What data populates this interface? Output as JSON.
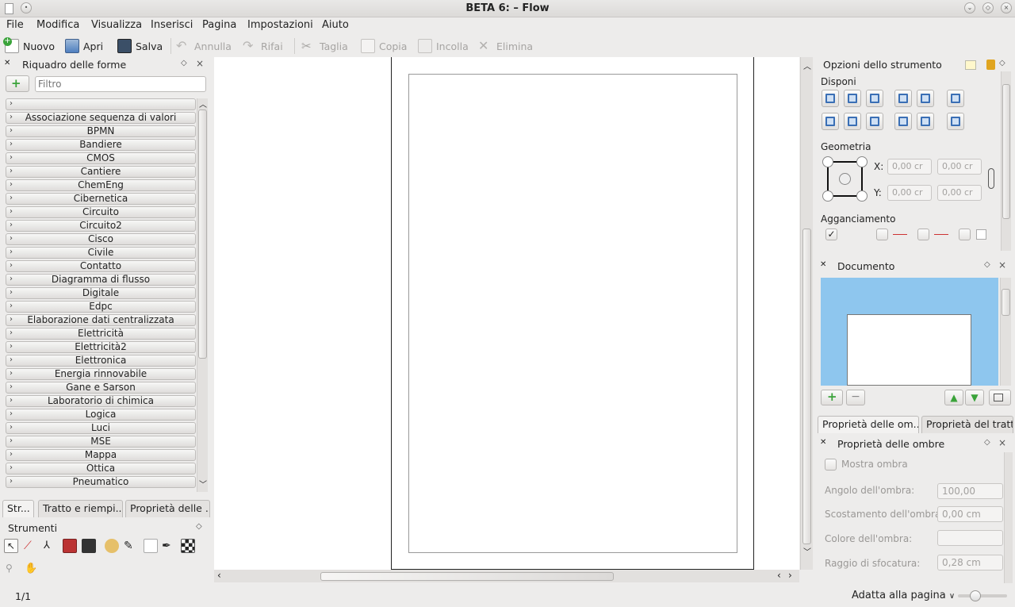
{
  "window": {
    "title": "BETA 6: – Flow"
  },
  "menu": [
    "File",
    "Modifica",
    "Visualizza",
    "Inserisci",
    "Pagina",
    "Impostazioni",
    "Aiuto"
  ],
  "toolbar": {
    "new": "Nuovo",
    "open": "Apri",
    "save": "Salva",
    "undo": "Annulla",
    "redo": "Rifai",
    "cut": "Taglia",
    "copy": "Copia",
    "paste": "Incolla",
    "delete": "Elimina"
  },
  "shapes_panel": {
    "title": "Riquadro delle forme",
    "filter_placeholder": "Filtro",
    "categories": [
      "",
      "Associazione sequenza di valori",
      "BPMN",
      "Bandiere",
      "CMOS",
      "Cantiere",
      "ChemEng",
      "Cibernetica",
      "Circuito",
      "Circuito2",
      "Cisco",
      "Civile",
      "Contatto",
      "Diagramma di flusso",
      "Digitale",
      "Edpc",
      "Elaborazione dati centralizzata",
      "Elettricità",
      "Elettricità2",
      "Elettronica",
      "Energia rinnovabile",
      "Gane e Sarson",
      "Laboratorio di chimica",
      "Logica",
      "Luci",
      "MSE",
      "Mappa",
      "Ottica",
      "Pneumatico"
    ]
  },
  "left_tabs": [
    "Str...",
    "Tratto e riempi...",
    "Proprietà delle ..."
  ],
  "tools_panel": {
    "title": "Strumenti"
  },
  "tool_options": {
    "title": "Opzioni dello strumento",
    "arrange_label": "Disponi",
    "geometry_label": "Geometria",
    "x_label": "X:",
    "y_label": "Y:",
    "x_value": "0,00 cr",
    "x_value2": "0,00 cr",
    "y_value": "0,00 cr",
    "y_value2": "0,00 cr",
    "snapping_label": "Agganciamento"
  },
  "document_panel": {
    "title": "Documento"
  },
  "right_tabs": [
    "Proprietà delle om...",
    "Proprietà del tratto"
  ],
  "shadow_panel": {
    "title": "Proprietà delle ombre",
    "show_shadow": "Mostra ombra",
    "angle_label": "Angolo dell'ombra:",
    "angle_value": "100,00",
    "offset_label": "Scostamento dell'ombra:",
    "offset_value": "0,00 cm",
    "color_label": "Colore dell'ombra:",
    "blur_label": "Raggio di sfocatura:",
    "blur_value": "0,28 cm"
  },
  "status": {
    "page": "1/1",
    "zoom": "Adatta alla pagina"
  },
  "colors": {
    "accent": "#3a6fb5",
    "doc_preview_bg": "#8ec6ee",
    "green_add": "#3aa33a"
  }
}
